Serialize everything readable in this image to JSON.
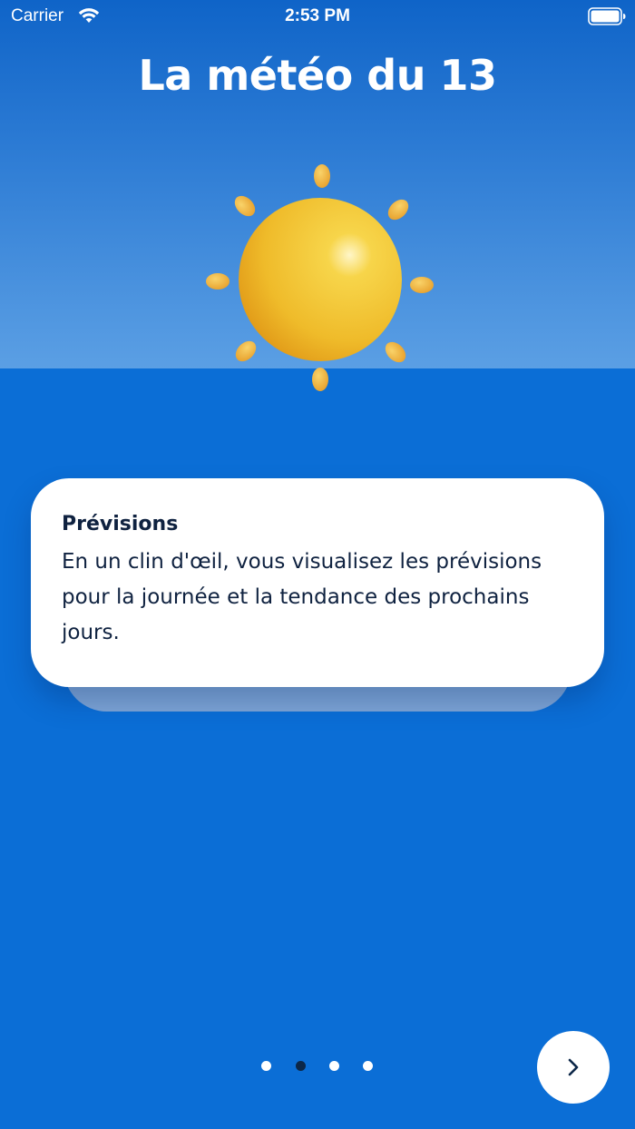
{
  "status_bar": {
    "carrier": "Carrier",
    "time": "2:53 PM",
    "wifi_icon": "wifi-icon",
    "battery_icon": "battery-full-icon"
  },
  "header": {
    "title": "La météo du 13"
  },
  "illustration": {
    "icon": "sun-icon"
  },
  "card": {
    "title": "Prévisions",
    "text": "En un clin d'œil, vous visualisez les prévisions pour la journée et la tendance des prochains jours."
  },
  "pager": {
    "total_pages": 4,
    "current_page": 2
  },
  "navigation": {
    "next_icon": "chevron-right-icon"
  },
  "colors": {
    "background": "#0b6ed6",
    "card": "#ffffff",
    "text_dark": "#0f2240",
    "sun": "#f2c12e",
    "ray": "#f0a83a"
  }
}
